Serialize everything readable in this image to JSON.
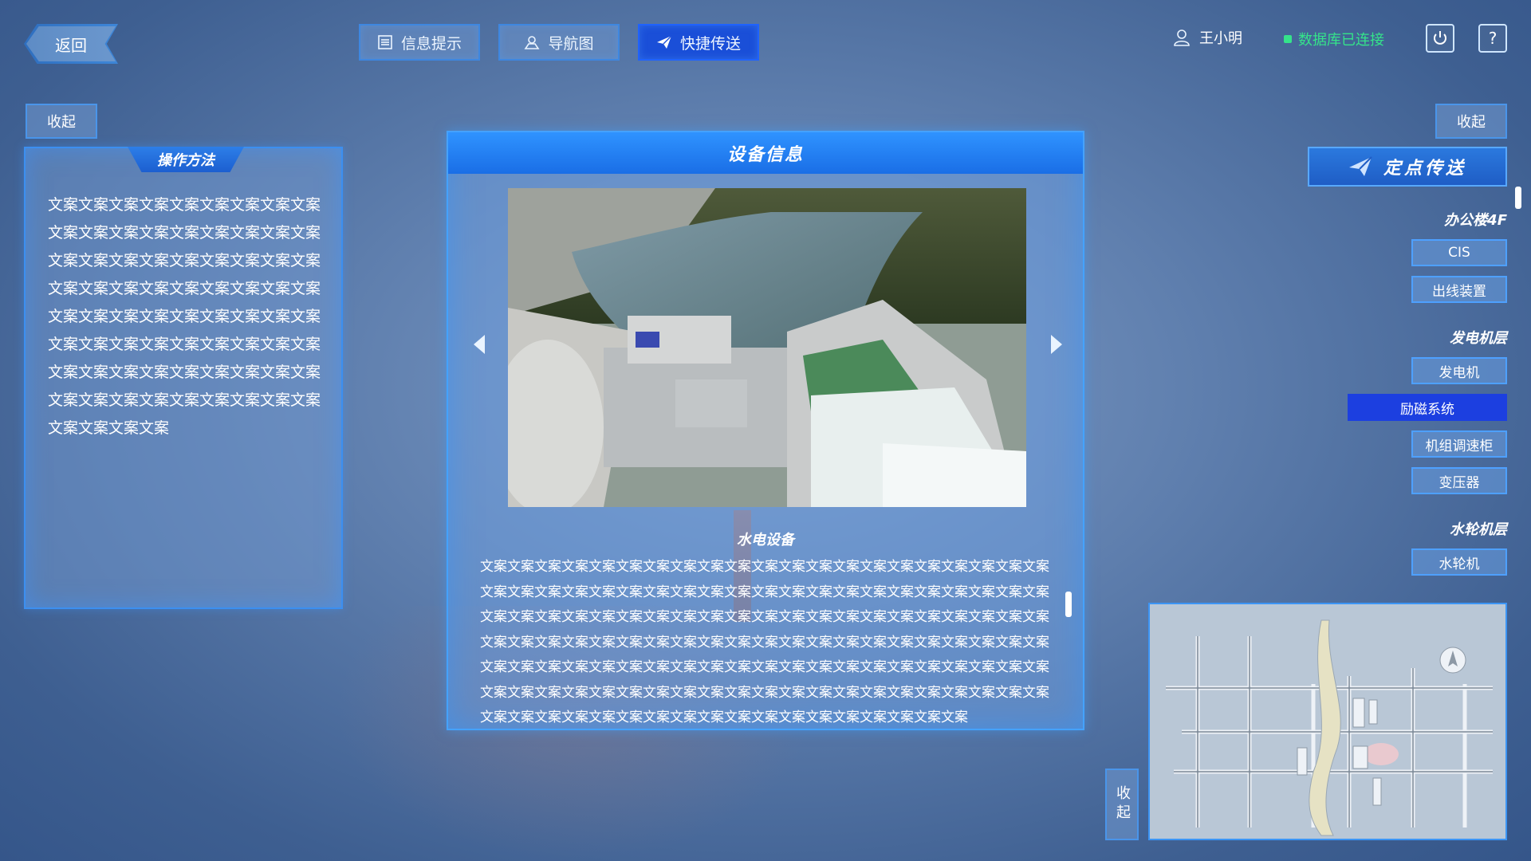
{
  "header": {
    "back_label": "返回",
    "tabs": [
      {
        "label": "信息提示",
        "icon": "list-icon",
        "active": false
      },
      {
        "label": "导航图",
        "icon": "map-pin-icon",
        "active": false
      },
      {
        "label": "快捷传送",
        "icon": "paper-plane-icon",
        "active": true
      }
    ],
    "user_name": "王小明",
    "db_status": "数据库已连接",
    "power_icon": "power-icon",
    "help_icon": "help-icon"
  },
  "left": {
    "collapse_label": "收起",
    "panel_title": "操作方法",
    "body_text": "文案文案文案文案文案文案文案文案文案文案文案文案文案文案文案文案文案文案文案文案文案文案文案文案文案文案文案文案文案文案文案文案文案文案文案文案文案文案文案文案文案文案文案文案文案文案文案文案文案文案文案文案文案文案文案文案文案文案文案文案文案文案文案文案文案文案文案文案文案文案文案文案文案文案文案文案"
  },
  "modal": {
    "title": "设备信息",
    "caption": "水电设备",
    "description": "文案文案文案文案文案文案文案文案文案文案文案文案文案文案文案文案文案文案文案文案文案文案文案文案文案文案文案文案文案文案文案文案文案文案文案文案文案文案文案文案文案文案文案文案文案文案文案文案文案文案文案文案文案文案文案文案文案文案文案文案文案文案文案文案文案文案文案文案文案文案文案文案文案文案文案文案文案文案文案文案文案文案文案文案文案文案文案文案文案文案文案文案文案文案文案文案文案文案文案文案文案文案文案文案文案文案文案文案文案文案文案文案文案文案文案文案文案文案文案文案文案文案文案文案文案文案文案文案文案文案文案文案文案文案文案文案文案文案文案文案文案文案文案文案"
  },
  "right": {
    "collapse_label": "收起",
    "quick_send_label": "定点传送",
    "groups": [
      {
        "title": "办公楼4F",
        "items": [
          {
            "label": "CIS",
            "active": false
          },
          {
            "label": "出线装置",
            "active": false
          }
        ]
      },
      {
        "title": "发电机层",
        "items": [
          {
            "label": "发电机",
            "active": false
          },
          {
            "label": "励磁系统",
            "active": true
          },
          {
            "label": "机组调速柜",
            "active": false
          },
          {
            "label": "变压器",
            "active": false
          }
        ]
      },
      {
        "title": "水轮机层",
        "items": [
          {
            "label": "水轮机",
            "active": false
          }
        ]
      }
    ],
    "map_collapse_label": "收起"
  }
}
